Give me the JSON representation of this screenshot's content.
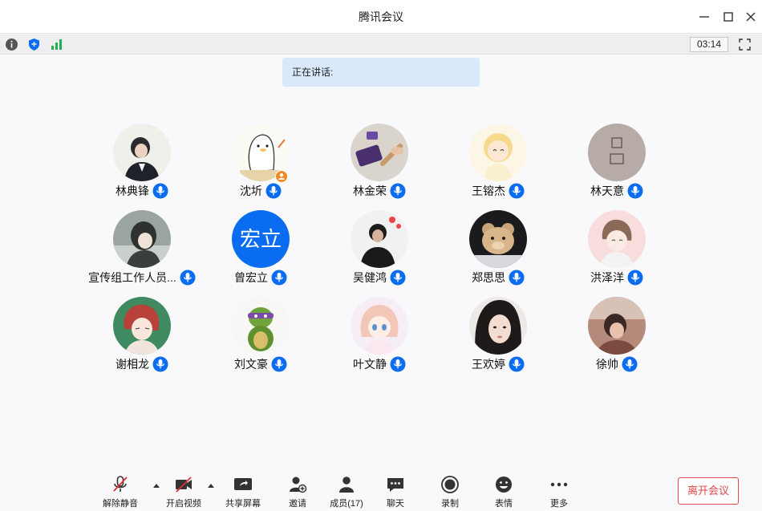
{
  "window": {
    "title": "腾讯会议"
  },
  "status": {
    "timer": "03:14"
  },
  "speaking": {
    "label": "正在讲话:"
  },
  "participants": [
    {
      "name": "林典锋"
    },
    {
      "name": "沈圻"
    },
    {
      "name": "林金荣"
    },
    {
      "name": "王镕杰"
    },
    {
      "name": "林天意"
    },
    {
      "name": "宣传组工作人员..."
    },
    {
      "name": "曾宏立",
      "avatar_text": "宏立"
    },
    {
      "name": "吴健鸿"
    },
    {
      "name": "郑思思"
    },
    {
      "name": "洪泽洋"
    },
    {
      "name": "谢相龙"
    },
    {
      "name": "刘文豪"
    },
    {
      "name": "叶文静"
    },
    {
      "name": "王欢婷"
    },
    {
      "name": "徐帅"
    }
  ],
  "toolbar": {
    "unmute": "解除静音",
    "start_video": "开启视频",
    "share_screen": "共享屏幕",
    "invite": "邀请",
    "members": "成员(17)",
    "chat": "聊天",
    "record": "录制",
    "reactions": "表情",
    "more": "更多",
    "leave": "离开会议"
  },
  "colors": {
    "accent": "#0a6cf0",
    "leave": "#e5474a",
    "banner": "#d9e8fb",
    "muted_red": "#e02b2b"
  }
}
